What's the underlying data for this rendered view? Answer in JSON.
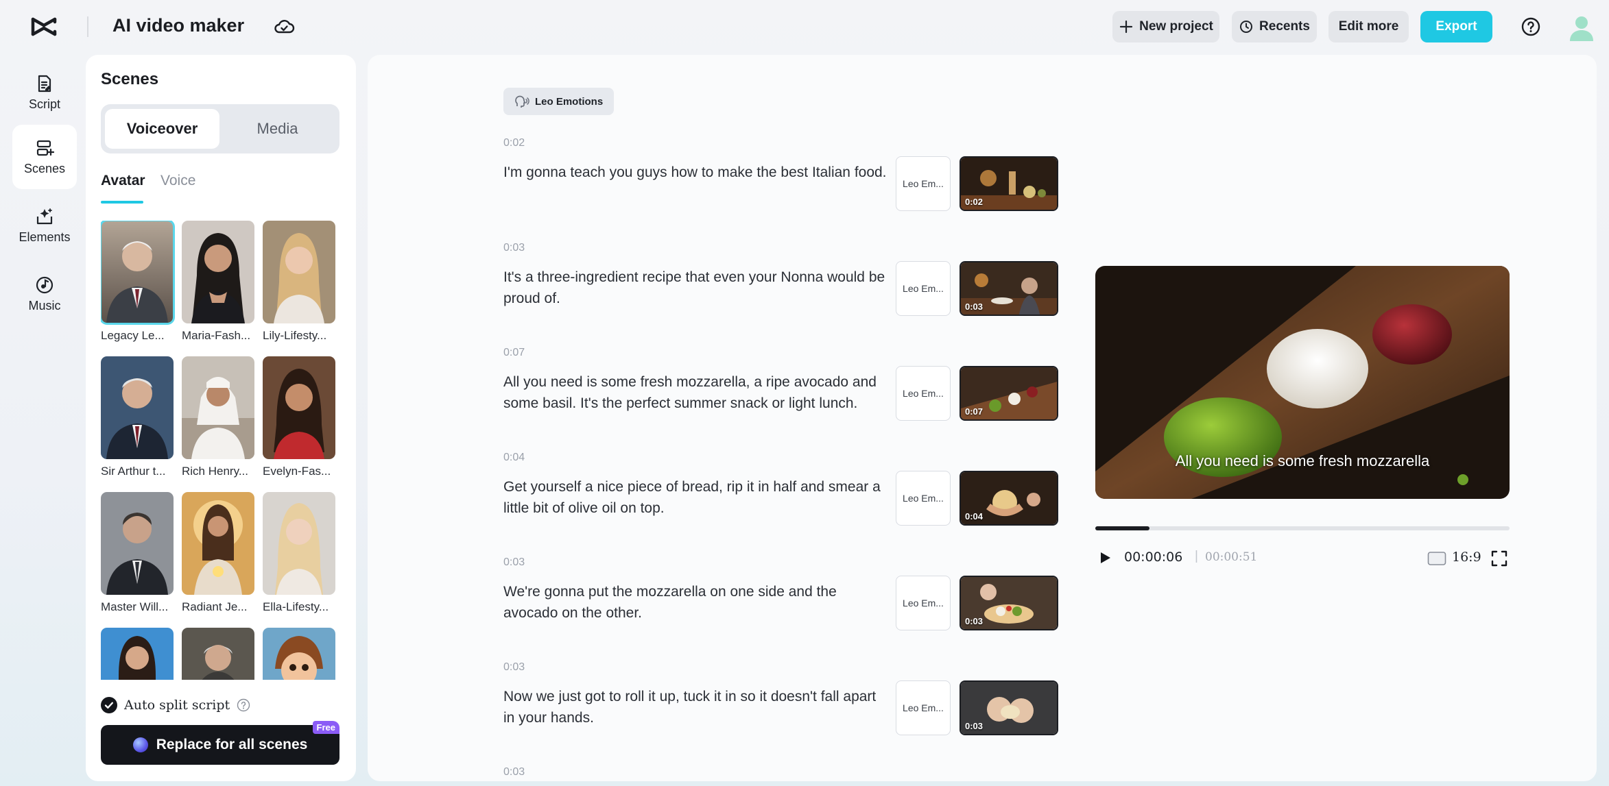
{
  "header": {
    "app_title": "AI video maker",
    "buttons": {
      "new_project": "New project",
      "recents": "Recents",
      "edit_more": "Edit more",
      "export": "Export"
    },
    "accent_color": "#1fc8e3"
  },
  "leftnav": {
    "items": [
      {
        "label": "Script",
        "icon": "script-icon",
        "active": false
      },
      {
        "label": "Scenes",
        "icon": "scenes-icon",
        "active": true
      },
      {
        "label": "Elements",
        "icon": "elements-icon",
        "active": false
      },
      {
        "label": "Music",
        "icon": "music-icon",
        "active": false
      }
    ]
  },
  "scenes_panel": {
    "title": "Scenes",
    "segments": {
      "voiceover": "Voiceover",
      "media": "Media",
      "selected": "Voiceover"
    },
    "subtabs": {
      "avatar": "Avatar",
      "voice": "Voice",
      "selected": "Avatar"
    },
    "avatars": [
      {
        "name": "Legacy Le...",
        "selected": true
      },
      {
        "name": "Maria-Fash..."
      },
      {
        "name": "Lily-Lifesty..."
      },
      {
        "name": "Sir Arthur t..."
      },
      {
        "name": "Rich Henry..."
      },
      {
        "name": "Evelyn-Fas..."
      },
      {
        "name": "Master Will..."
      },
      {
        "name": "Radiant Je..."
      },
      {
        "name": "Ella-Lifesty..."
      },
      {
        "name": ""
      },
      {
        "name": ""
      },
      {
        "name": ""
      }
    ],
    "auto_split_label": "Auto split script",
    "auto_split_checked": true,
    "replace_button": "Replace for all scenes",
    "free_badge": "Free"
  },
  "script": {
    "emotion_chip": "Leo Emotions",
    "scenes": [
      {
        "time": "0:02",
        "text": "I'm gonna teach you guys how to make the best Italian food.",
        "voice": "Leo Em...",
        "thumb_time": "0:02"
      },
      {
        "time": "0:03",
        "text": "It's a three-ingredient recipe that even your Nonna would be proud of.",
        "voice": "Leo Em...",
        "thumb_time": "0:03"
      },
      {
        "time": "0:07",
        "text": "All you need is some fresh mozzarella, a ripe avocado and some basil. It's the perfect summer snack or light lunch.",
        "voice": "Leo Em...",
        "thumb_time": "0:07"
      },
      {
        "time": "0:04",
        "text": "Get yourself a nice piece of bread, rip it in half and smear a little bit of olive oil on top.",
        "voice": "Leo Em...",
        "thumb_time": "0:04"
      },
      {
        "time": "0:03",
        "text": "We're gonna put the mozzarella on one side and the avocado on the other.",
        "voice": "Leo Em...",
        "thumb_time": "0:03"
      },
      {
        "time": "0:03",
        "text": "Now we just got to roll it up, tuck it in so it doesn't fall apart in your hands.",
        "voice": "Leo Em...",
        "thumb_time": "0:03"
      },
      {
        "time": "0:03",
        "text": "",
        "voice": "",
        "thumb_time": ""
      }
    ]
  },
  "preview": {
    "caption": "All you need is some fresh mozzarella",
    "current_time": "00:00:06",
    "separator": "|",
    "total_time": "00:00:51",
    "progress_fraction": 0.13,
    "aspect_ratio": "16:9"
  }
}
